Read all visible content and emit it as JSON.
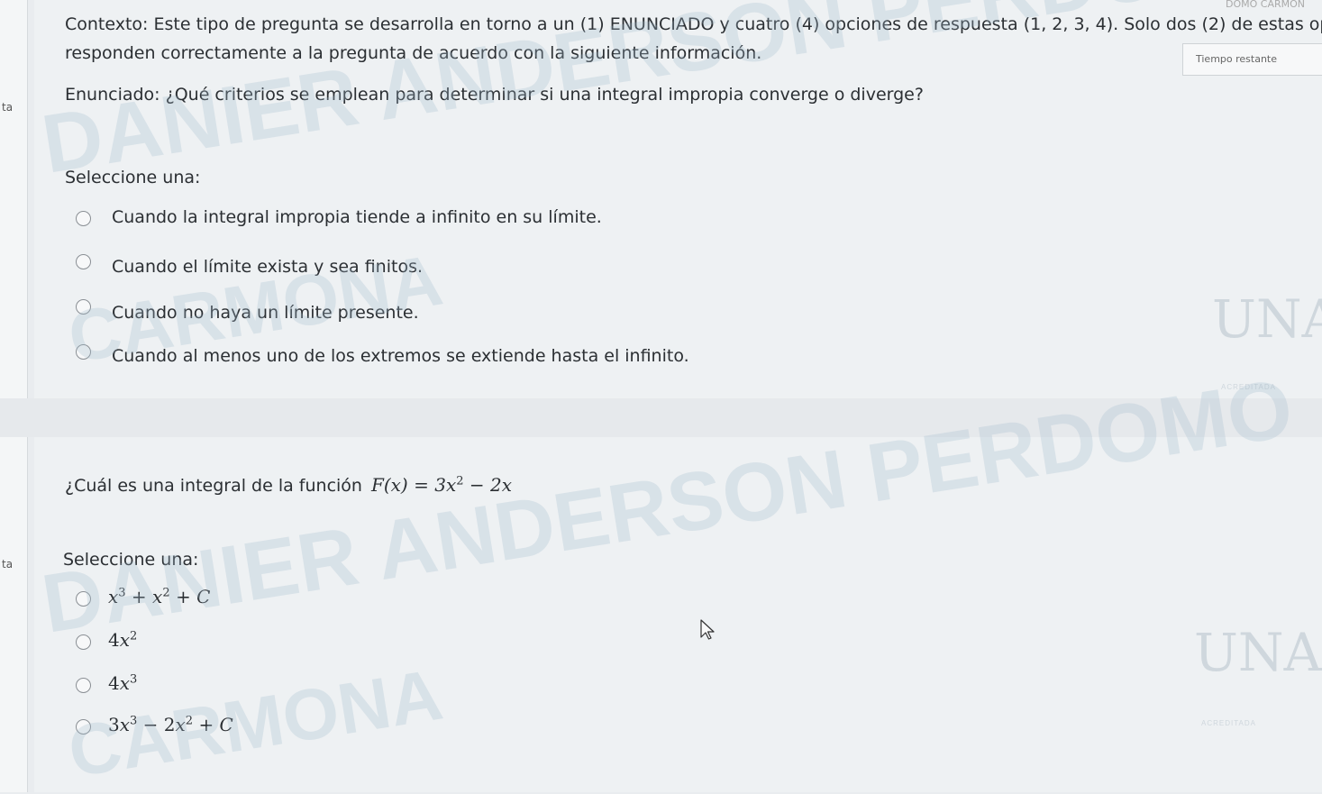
{
  "sidebar": {
    "label_q1": "ta",
    "label_q2": "ta"
  },
  "timer": {
    "label": "Tiempo restante"
  },
  "header": {
    "user_partial": "DOMO CARMON"
  },
  "question1": {
    "context_line1": "Contexto: Este tipo de pregunta se desarrolla en torno a un (1) ENUNCIADO y cuatro (4) opciones de respuesta (1, 2, 3, 4). Solo dos (2) de estas opciones",
    "context_line2": "responden correctamente a la pregunta de acuerdo con la siguiente información.",
    "statement": "Enunciado: ¿Qué criterios se emplean para determinar si una integral impropia converge o diverge?",
    "select_label": "Seleccione una:",
    "options": [
      "Cuando la integral impropia tiende a infinito en su límite.",
      "Cuando el límite exista y sea finitos.",
      "Cuando no haya un límite presente.",
      "Cuando al menos uno de los extremos se extiende hasta el infinito."
    ]
  },
  "question2": {
    "prompt": "¿Cuál es una integral de la función",
    "select_label": "Seleccione una:"
  },
  "watermark": {
    "line1": "DANIER ANDERSON PERDOMO",
    "line2": "CARMONA"
  },
  "logo": {
    "letters": "UNAD",
    "seal": "ACREDITADA"
  }
}
